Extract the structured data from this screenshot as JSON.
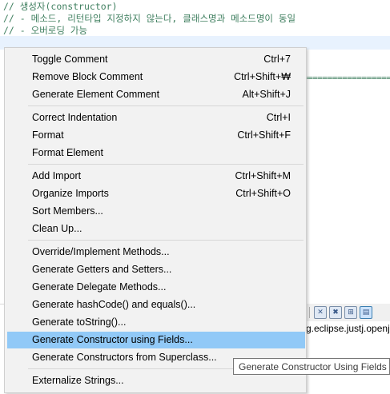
{
  "editor": {
    "lines": [
      "// 생성자(constructor)",
      "// - 메소드, 리턴타입 지정하지 않는다, 클래스명과 메소드명이 동일",
      "// - 오버로딩 가능"
    ],
    "eq_text": "===================="
  },
  "console": {
    "path_text": "g.eclipse.justj.openj",
    "toolbar_icons": [
      "remove-launch-icon",
      "remove-all-icon",
      "pin-console-icon",
      "display-selected-console-icon"
    ]
  },
  "menu": {
    "items": [
      {
        "label": "Toggle Comment",
        "accel": "Ctrl+7"
      },
      {
        "label": "Remove Block Comment",
        "accel": "Ctrl+Shift+₩"
      },
      {
        "label": "Generate Element Comment",
        "accel": "Alt+Shift+J"
      },
      {
        "label": "Correct Indentation",
        "accel": "Ctrl+I"
      },
      {
        "label": "Format",
        "accel": "Ctrl+Shift+F"
      },
      {
        "label": "Format Element",
        "accel": ""
      },
      {
        "label": "Add Import",
        "accel": "Ctrl+Shift+M"
      },
      {
        "label": "Organize Imports",
        "accel": "Ctrl+Shift+O"
      },
      {
        "label": "Sort Members...",
        "accel": ""
      },
      {
        "label": "Clean Up...",
        "accel": ""
      },
      {
        "label": "Override/Implement Methods...",
        "accel": ""
      },
      {
        "label": "Generate Getters and Setters...",
        "accel": ""
      },
      {
        "label": "Generate Delegate Methods...",
        "accel": ""
      },
      {
        "label": "Generate hashCode() and equals()...",
        "accel": ""
      },
      {
        "label": "Generate toString()...",
        "accel": ""
      },
      {
        "label": "Generate Constructor using Fields...",
        "accel": ""
      },
      {
        "label": "Generate Constructors from Superclass...",
        "accel": ""
      },
      {
        "label": "Externalize Strings...",
        "accel": ""
      }
    ],
    "selected_label": "Generate Constructor using Fields..."
  },
  "tooltip": {
    "text": "Generate Constructor Using Fields"
  },
  "colors": {
    "selection": "#91c9f7",
    "menu_bg": "#f2f2f2",
    "comment_green": "#3f7f5f"
  }
}
